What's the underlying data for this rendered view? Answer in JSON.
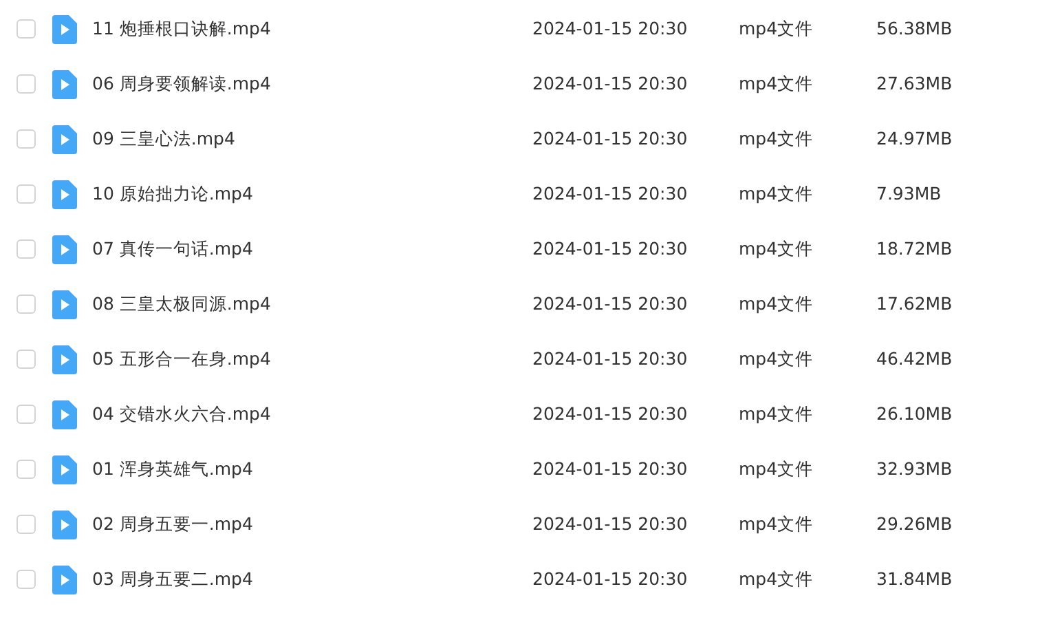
{
  "files": [
    {
      "name": "11 炮捶根口诀解.mp4",
      "modified": "2024-01-15 20:30",
      "type": "mp4文件",
      "size": "56.38MB",
      "checked": false
    },
    {
      "name": "06 周身要领解读.mp4",
      "modified": "2024-01-15 20:30",
      "type": "mp4文件",
      "size": "27.63MB",
      "checked": false
    },
    {
      "name": "09 三皇心法.mp4",
      "modified": "2024-01-15 20:30",
      "type": "mp4文件",
      "size": "24.97MB",
      "checked": false
    },
    {
      "name": "10 原始拙力论.mp4",
      "modified": "2024-01-15 20:30",
      "type": "mp4文件",
      "size": "7.93MB",
      "checked": false
    },
    {
      "name": "07 真传一句话.mp4",
      "modified": "2024-01-15 20:30",
      "type": "mp4文件",
      "size": "18.72MB",
      "checked": false
    },
    {
      "name": "08 三皇太极同源.mp4",
      "modified": "2024-01-15 20:30",
      "type": "mp4文件",
      "size": "17.62MB",
      "checked": false
    },
    {
      "name": "05 五形合一在身.mp4",
      "modified": "2024-01-15 20:30",
      "type": "mp4文件",
      "size": "46.42MB",
      "checked": false
    },
    {
      "name": "04 交错水火六合.mp4",
      "modified": "2024-01-15 20:30",
      "type": "mp4文件",
      "size": "26.10MB",
      "checked": false
    },
    {
      "name": "01 浑身英雄气.mp4",
      "modified": "2024-01-15 20:30",
      "type": "mp4文件",
      "size": "32.93MB",
      "checked": false
    },
    {
      "name": "02 周身五要一.mp4",
      "modified": "2024-01-15 20:30",
      "type": "mp4文件",
      "size": "29.26MB",
      "checked": false
    },
    {
      "name": "03 周身五要二.mp4",
      "modified": "2024-01-15 20:30",
      "type": "mp4文件",
      "size": "31.84MB",
      "checked": false
    }
  ]
}
